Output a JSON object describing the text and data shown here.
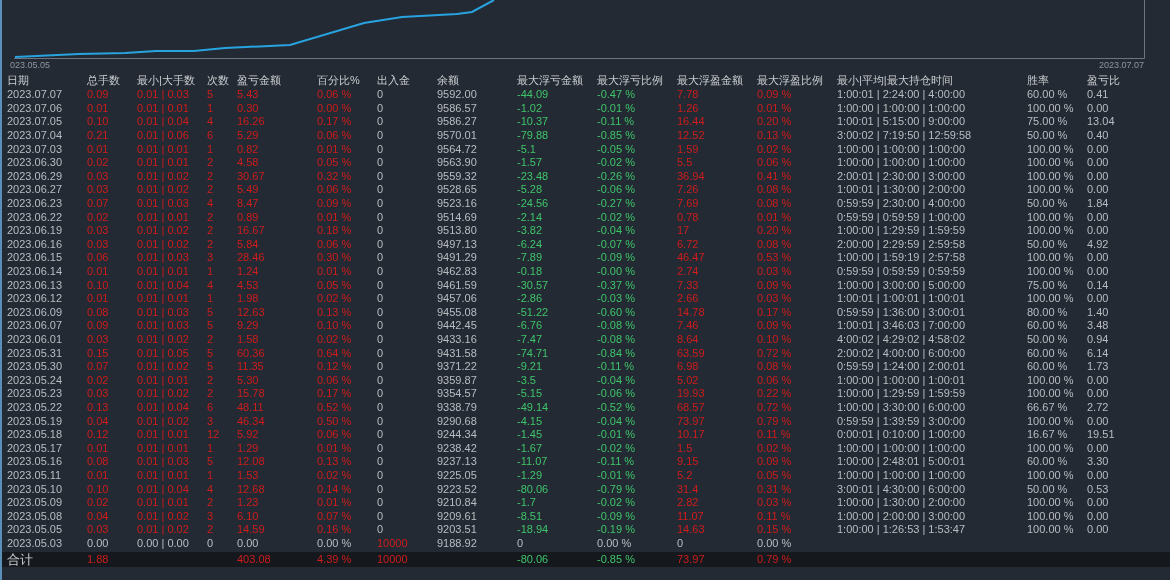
{
  "chart": {
    "start_label": "023.05.05",
    "end_label": "2023.07.07"
  },
  "table": {
    "columns": [
      {
        "label": "日期",
        "kind": "plain"
      },
      {
        "label": "总手数",
        "kind": "profit"
      },
      {
        "label": "最小|大手数",
        "kind": "profit"
      },
      {
        "label": "次数",
        "kind": "profit"
      },
      {
        "label": "盈亏金额",
        "kind": "profit"
      },
      {
        "label": "百分比%",
        "kind": "profit"
      },
      {
        "label": "出入金",
        "kind": "cash"
      },
      {
        "label": "余额",
        "kind": "plain"
      },
      {
        "label": "最大浮亏金额",
        "kind": "loss"
      },
      {
        "label": "最大浮亏比例",
        "kind": "loss"
      },
      {
        "label": "最大浮盈金额",
        "kind": "profit"
      },
      {
        "label": "最大浮盈比例",
        "kind": "profit"
      },
      {
        "label": "最小|平均|最大持仓时间",
        "kind": "plain"
      },
      {
        "label": "胜率",
        "kind": "plain"
      },
      {
        "label": "盈亏比",
        "kind": "plain"
      }
    ],
    "rows": [
      {
        "kind": "trade",
        "cells": [
          "2023.07.07",
          "0.09",
          "0.01 | 0.03",
          "5",
          "5.43",
          "0.06 %",
          "0",
          "9592.00",
          "-44.09",
          "-0.47 %",
          "7.78",
          "0.09 %",
          "1:00:01 | 2:24:00 | 4:00:00",
          "60.00 %",
          "0.41"
        ]
      },
      {
        "kind": "trade",
        "cells": [
          "2023.07.06",
          "0.01",
          "0.01 | 0.01",
          "1",
          "0.30",
          "0.00 %",
          "0",
          "9586.57",
          "-1.02",
          "-0.01 %",
          "1.26",
          "0.01 %",
          "1:00:00 | 1:00:00 | 1:00:00",
          "100.00 %",
          "0.00"
        ]
      },
      {
        "kind": "trade",
        "cells": [
          "2023.07.05",
          "0.10",
          "0.01 | 0.04",
          "4",
          "16.26",
          "0.17 %",
          "0",
          "9586.27",
          "-10.37",
          "-0.11 %",
          "16.44",
          "0.20 %",
          "1:00:01 | 5:15:00 | 9:00:00",
          "75.00 %",
          "13.04"
        ]
      },
      {
        "kind": "trade",
        "cells": [
          "2023.07.04",
          "0.21",
          "0.01 | 0.06",
          "6",
          "5.29",
          "0.06 %",
          "0",
          "9570.01",
          "-79.88",
          "-0.85 %",
          "12.52",
          "0.13 %",
          "3:00:02 | 7:19:50 | 12:59:58",
          "50.00 %",
          "0.40"
        ]
      },
      {
        "kind": "trade",
        "cells": [
          "2023.07.03",
          "0.01",
          "0.01 | 0.01",
          "1",
          "0.82",
          "0.01 %",
          "0",
          "9564.72",
          "-5.1",
          "-0.05 %",
          "1.59",
          "0.02 %",
          "1:00:00 | 1:00:00 | 1:00:00",
          "100.00 %",
          "0.00"
        ]
      },
      {
        "kind": "trade",
        "cells": [
          "2023.06.30",
          "0.02",
          "0.01 | 0.01",
          "2",
          "4.58",
          "0.05 %",
          "0",
          "9563.90",
          "-1.57",
          "-0.02 %",
          "5.5",
          "0.06 %",
          "1:00:00 | 1:00:00 | 1:00:00",
          "100.00 %",
          "0.00"
        ]
      },
      {
        "kind": "trade",
        "cells": [
          "2023.06.29",
          "0.03",
          "0.01 | 0.02",
          "2",
          "30.67",
          "0.32 %",
          "0",
          "9559.32",
          "-23.48",
          "-0.26 %",
          "36.94",
          "0.41 %",
          "2:00:01 | 2:30:00 | 3:00:00",
          "100.00 %",
          "0.00"
        ]
      },
      {
        "kind": "trade",
        "cells": [
          "2023.06.27",
          "0.03",
          "0.01 | 0.02",
          "2",
          "5.49",
          "0.06 %",
          "0",
          "9528.65",
          "-5.28",
          "-0.06 %",
          "7.26",
          "0.08 %",
          "1:00:01 | 1:30:00 | 2:00:00",
          "100.00 %",
          "0.00"
        ]
      },
      {
        "kind": "trade",
        "cells": [
          "2023.06.23",
          "0.07",
          "0.01 | 0.03",
          "4",
          "8.47",
          "0.09 %",
          "0",
          "9523.16",
          "-24.56",
          "-0.27 %",
          "7.69",
          "0.08 %",
          "0:59:59 | 2:30:00 | 4:00:00",
          "50.00 %",
          "1.84"
        ]
      },
      {
        "kind": "trade",
        "cells": [
          "2023.06.22",
          "0.02",
          "0.01 | 0.01",
          "2",
          "0.89",
          "0.01 %",
          "0",
          "9514.69",
          "-2.14",
          "-0.02 %",
          "0.78",
          "0.01 %",
          "0:59:59 | 0:59:59 | 1:00:00",
          "100.00 %",
          "0.00"
        ]
      },
      {
        "kind": "trade",
        "cells": [
          "2023.06.19",
          "0.03",
          "0.01 | 0.02",
          "2",
          "16.67",
          "0.18 %",
          "0",
          "9513.80",
          "-3.82",
          "-0.04 %",
          "17",
          "0.20 %",
          "1:00:00 | 1:29:59 | 1:59:59",
          "100.00 %",
          "0.00"
        ]
      },
      {
        "kind": "trade",
        "cells": [
          "2023.06.16",
          "0.03",
          "0.01 | 0.02",
          "2",
          "5.84",
          "0.06 %",
          "0",
          "9497.13",
          "-6.24",
          "-0.07 %",
          "6.72",
          "0.08 %",
          "2:00:00 | 2:29:59 | 2:59:58",
          "50.00 %",
          "4.92"
        ]
      },
      {
        "kind": "trade",
        "cells": [
          "2023.06.15",
          "0.06",
          "0.01 | 0.03",
          "3",
          "28.46",
          "0.30 %",
          "0",
          "9491.29",
          "-7.89",
          "-0.09 %",
          "46.47",
          "0.53 %",
          "1:00:00 | 1:59:19 | 2:57:58",
          "100.00 %",
          "0.00"
        ]
      },
      {
        "kind": "trade",
        "cells": [
          "2023.06.14",
          "0.01",
          "0.01 | 0.01",
          "1",
          "1.24",
          "0.01 %",
          "0",
          "9462.83",
          "-0.18",
          "-0.00 %",
          "2.74",
          "0.03 %",
          "0:59:59 | 0:59:59 | 0:59:59",
          "100.00 %",
          "0.00"
        ]
      },
      {
        "kind": "trade",
        "cells": [
          "2023.06.13",
          "0.10",
          "0.01 | 0.04",
          "4",
          "4.53",
          "0.05 %",
          "0",
          "9461.59",
          "-30.57",
          "-0.37 %",
          "7.33",
          "0.09 %",
          "1:00:00 | 3:00:00 | 5:00:00",
          "75.00 %",
          "0.14"
        ]
      },
      {
        "kind": "trade",
        "cells": [
          "2023.06.12",
          "0.01",
          "0.01 | 0.01",
          "1",
          "1.98",
          "0.02 %",
          "0",
          "9457.06",
          "-2.86",
          "-0.03 %",
          "2.66",
          "0.03 %",
          "1:00:01 | 1:00:01 | 1:00:01",
          "100.00 %",
          "0.00"
        ]
      },
      {
        "kind": "trade",
        "cells": [
          "2023.06.09",
          "0.08",
          "0.01 | 0.03",
          "5",
          "12.63",
          "0.13 %",
          "0",
          "9455.08",
          "-51.22",
          "-0.60 %",
          "14.78",
          "0.17 %",
          "0:59:59 | 1:36:00 | 3:00:01",
          "80.00 %",
          "1.40"
        ]
      },
      {
        "kind": "trade",
        "cells": [
          "2023.06.07",
          "0.09",
          "0.01 | 0.03",
          "5",
          "9.29",
          "0.10 %",
          "0",
          "9442.45",
          "-6.76",
          "-0.08 %",
          "7.46",
          "0.09 %",
          "1:00:01 | 3:46:03 | 7:00:00",
          "60.00 %",
          "3.48"
        ]
      },
      {
        "kind": "trade",
        "cells": [
          "2023.06.01",
          "0.03",
          "0.01 | 0.02",
          "2",
          "1.58",
          "0.02 %",
          "0",
          "9433.16",
          "-7.47",
          "-0.08 %",
          "8.64",
          "0.10 %",
          "4:00:02 | 4:29:02 | 4:58:02",
          "50.00 %",
          "0.94"
        ]
      },
      {
        "kind": "trade",
        "cells": [
          "2023.05.31",
          "0.15",
          "0.01 | 0.05",
          "5",
          "60.36",
          "0.64 %",
          "0",
          "9431.58",
          "-74.71",
          "-0.84 %",
          "63.59",
          "0.72 %",
          "2:00:02 | 4:00:00 | 6:00:00",
          "60.00 %",
          "6.14"
        ]
      },
      {
        "kind": "trade",
        "cells": [
          "2023.05.30",
          "0.07",
          "0.01 | 0.02",
          "5",
          "11.35",
          "0.12 %",
          "0",
          "9371.22",
          "-9.21",
          "-0.11 %",
          "6.98",
          "0.08 %",
          "0:59:59 | 1:24:00 | 2:00:01",
          "60.00 %",
          "1.73"
        ]
      },
      {
        "kind": "trade",
        "cells": [
          "2023.05.24",
          "0.02",
          "0.01 | 0.01",
          "2",
          "5.30",
          "0.06 %",
          "0",
          "9359.87",
          "-3.5",
          "-0.04 %",
          "5.02",
          "0.06 %",
          "1:00:00 | 1:00:00 | 1:00:01",
          "100.00 %",
          "0.00"
        ]
      },
      {
        "kind": "trade",
        "cells": [
          "2023.05.23",
          "0.03",
          "0.01 | 0.02",
          "2",
          "15.78",
          "0.17 %",
          "0",
          "9354.57",
          "-5.15",
          "-0.06 %",
          "19.93",
          "0.22 %",
          "1:00:00 | 1:29:59 | 1:59:59",
          "100.00 %",
          "0.00"
        ]
      },
      {
        "kind": "trade",
        "cells": [
          "2023.05.22",
          "0.13",
          "0.01 | 0.04",
          "6",
          "48.11",
          "0.52 %",
          "0",
          "9338.79",
          "-49.14",
          "-0.52 %",
          "68.57",
          "0.72 %",
          "1:00:00 | 3:30:00 | 6:00:00",
          "66.67 %",
          "2.72"
        ]
      },
      {
        "kind": "trade",
        "cells": [
          "2023.05.19",
          "0.04",
          "0.01 | 0.02",
          "3",
          "46.34",
          "0.50 %",
          "0",
          "9290.68",
          "-4.15",
          "-0.04 %",
          "73.97",
          "0.79 %",
          "0:59:59 | 1:39:59 | 3:00:00",
          "100.00 %",
          "0.00"
        ]
      },
      {
        "kind": "trade",
        "cells": [
          "2023.05.18",
          "0.12",
          "0.01 | 0.01",
          "12",
          "5.92",
          "0.06 %",
          "0",
          "9244.34",
          "-1.45",
          "-0.01 %",
          "10.17",
          "0.11 %",
          "0:00:01 | 0:10:00 | 1:00:00",
          "16.67 %",
          "19.51"
        ]
      },
      {
        "kind": "trade",
        "cells": [
          "2023.05.17",
          "0.01",
          "0.01 | 0.01",
          "1",
          "1.29",
          "0.01 %",
          "0",
          "9238.42",
          "-1.67",
          "-0.02 %",
          "1.5",
          "0.02 %",
          "1:00:00 | 1:00:00 | 1:00:00",
          "100.00 %",
          "0.00"
        ]
      },
      {
        "kind": "trade",
        "cells": [
          "2023.05.16",
          "0.08",
          "0.01 | 0.03",
          "5",
          "12.08",
          "0.13 %",
          "0",
          "9237.13",
          "-11.07",
          "-0.11 %",
          "9.15",
          "0.09 %",
          "1:00:00 | 2:48:01 | 5:00:01",
          "60.00 %",
          "3.30"
        ]
      },
      {
        "kind": "trade",
        "cells": [
          "2023.05.11",
          "0.01",
          "0.01 | 0.01",
          "1",
          "1.53",
          "0.02 %",
          "0",
          "9225.05",
          "-1.29",
          "-0.01 %",
          "5.2",
          "0.05 %",
          "1:00:00 | 1:00:00 | 1:00:00",
          "100.00 %",
          "0.00"
        ]
      },
      {
        "kind": "trade",
        "cells": [
          "2023.05.10",
          "0.10",
          "0.01 | 0.04",
          "4",
          "12.68",
          "0.14 %",
          "0",
          "9223.52",
          "-80.06",
          "-0.79 %",
          "31.4",
          "0.31 %",
          "3:00:01 | 4:30:00 | 6:00:00",
          "50.00 %",
          "0.53"
        ]
      },
      {
        "kind": "trade",
        "cells": [
          "2023.05.09",
          "0.02",
          "0.01 | 0.01",
          "2",
          "1.23",
          "0.01 %",
          "0",
          "9210.84",
          "-1.7",
          "-0.02 %",
          "2.82",
          "0.03 %",
          "1:00:00 | 1:30:00 | 2:00:00",
          "100.00 %",
          "0.00"
        ]
      },
      {
        "kind": "trade",
        "cells": [
          "2023.05.08",
          "0.04",
          "0.01 | 0.02",
          "3",
          "6.10",
          "0.07 %",
          "0",
          "9209.61",
          "-8.51",
          "-0.09 %",
          "11.07",
          "0.11 %",
          "1:00:00 | 2:00:00 | 3:00:00",
          "100.00 %",
          "0.00"
        ]
      },
      {
        "kind": "trade",
        "cells": [
          "2023.05.05",
          "0.03",
          "0.01 | 0.02",
          "2",
          "14.59",
          "0.16 %",
          "0",
          "9203.51",
          "-18.94",
          "-0.19 %",
          "14.63",
          "0.15 %",
          "1:00:00 | 1:26:53 | 1:53:47",
          "100.00 %",
          "0.00"
        ]
      },
      {
        "kind": "deposit",
        "cells": [
          "2023.05.03",
          "0.00",
          "0.00 | 0.00",
          "0",
          "0.00",
          "0.00 %",
          "10000",
          "9188.92",
          "0",
          "0.00 %",
          "0",
          "0.00 %"
        ]
      }
    ],
    "total": {
      "kind": "total",
      "cells": [
        "合计",
        "1.88",
        null,
        null,
        "403.08",
        "4.39 %",
        "10000",
        null,
        "-80.06",
        "-0.85 %",
        "73.97",
        "0.79 %"
      ]
    }
  }
}
